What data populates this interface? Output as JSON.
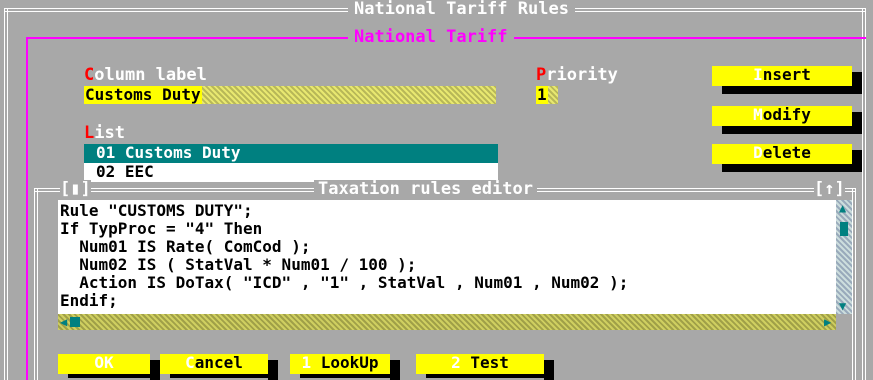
{
  "window": {
    "title": "National Tariff Rules",
    "group_title": "National Tariff"
  },
  "fields": {
    "column_label": {
      "hotkey": "C",
      "label_rest": "olumn label",
      "value": "Customs Duty"
    },
    "priority": {
      "hotkey": "P",
      "label_rest": "riority",
      "value": "1"
    },
    "list": {
      "hotkey": "L",
      "label_rest": "ist"
    }
  },
  "list_items": [
    {
      "text": "01 Customs Duty",
      "selected": true
    },
    {
      "text": "02 EEC",
      "selected": false
    }
  ],
  "side_buttons": {
    "insert": {
      "hotkey": "I",
      "rest": "nsert"
    },
    "modify": {
      "hotkey": "M",
      "rest": "odify"
    },
    "delete": {
      "hotkey": "D",
      "rest": "elete"
    }
  },
  "editor": {
    "title": "Taxation rules editor",
    "left_marker": "[▮]",
    "right_marker": "[↑]",
    "lines": [
      "Rule \"CUSTOMS DUTY\";",
      "If TypProc = \"4\" Then",
      "  Num01 IS Rate( ComCod );",
      "  Num02 IS ( StatVal * Num01 / 100 );",
      "  Action IS DoTax( \"ICD\" , \"1\" , StatVal , Num01 , Num02 );",
      "Endif;"
    ]
  },
  "bottom_buttons": {
    "ok": {
      "hotkey": "",
      "rest": "OK"
    },
    "cancel": {
      "hotkey": "C",
      "rest": "ancel"
    },
    "lookup": {
      "hotkey": "1",
      "rest": " LookUp"
    },
    "test": {
      "hotkey": "2",
      "rest": " Test"
    }
  },
  "colors": {
    "background": "#a8a8a8",
    "accent_magenta": "#ff00ff",
    "hotkey_red": "#ff0000",
    "button_yellow": "#ffff00",
    "selection_teal": "#008080"
  }
}
